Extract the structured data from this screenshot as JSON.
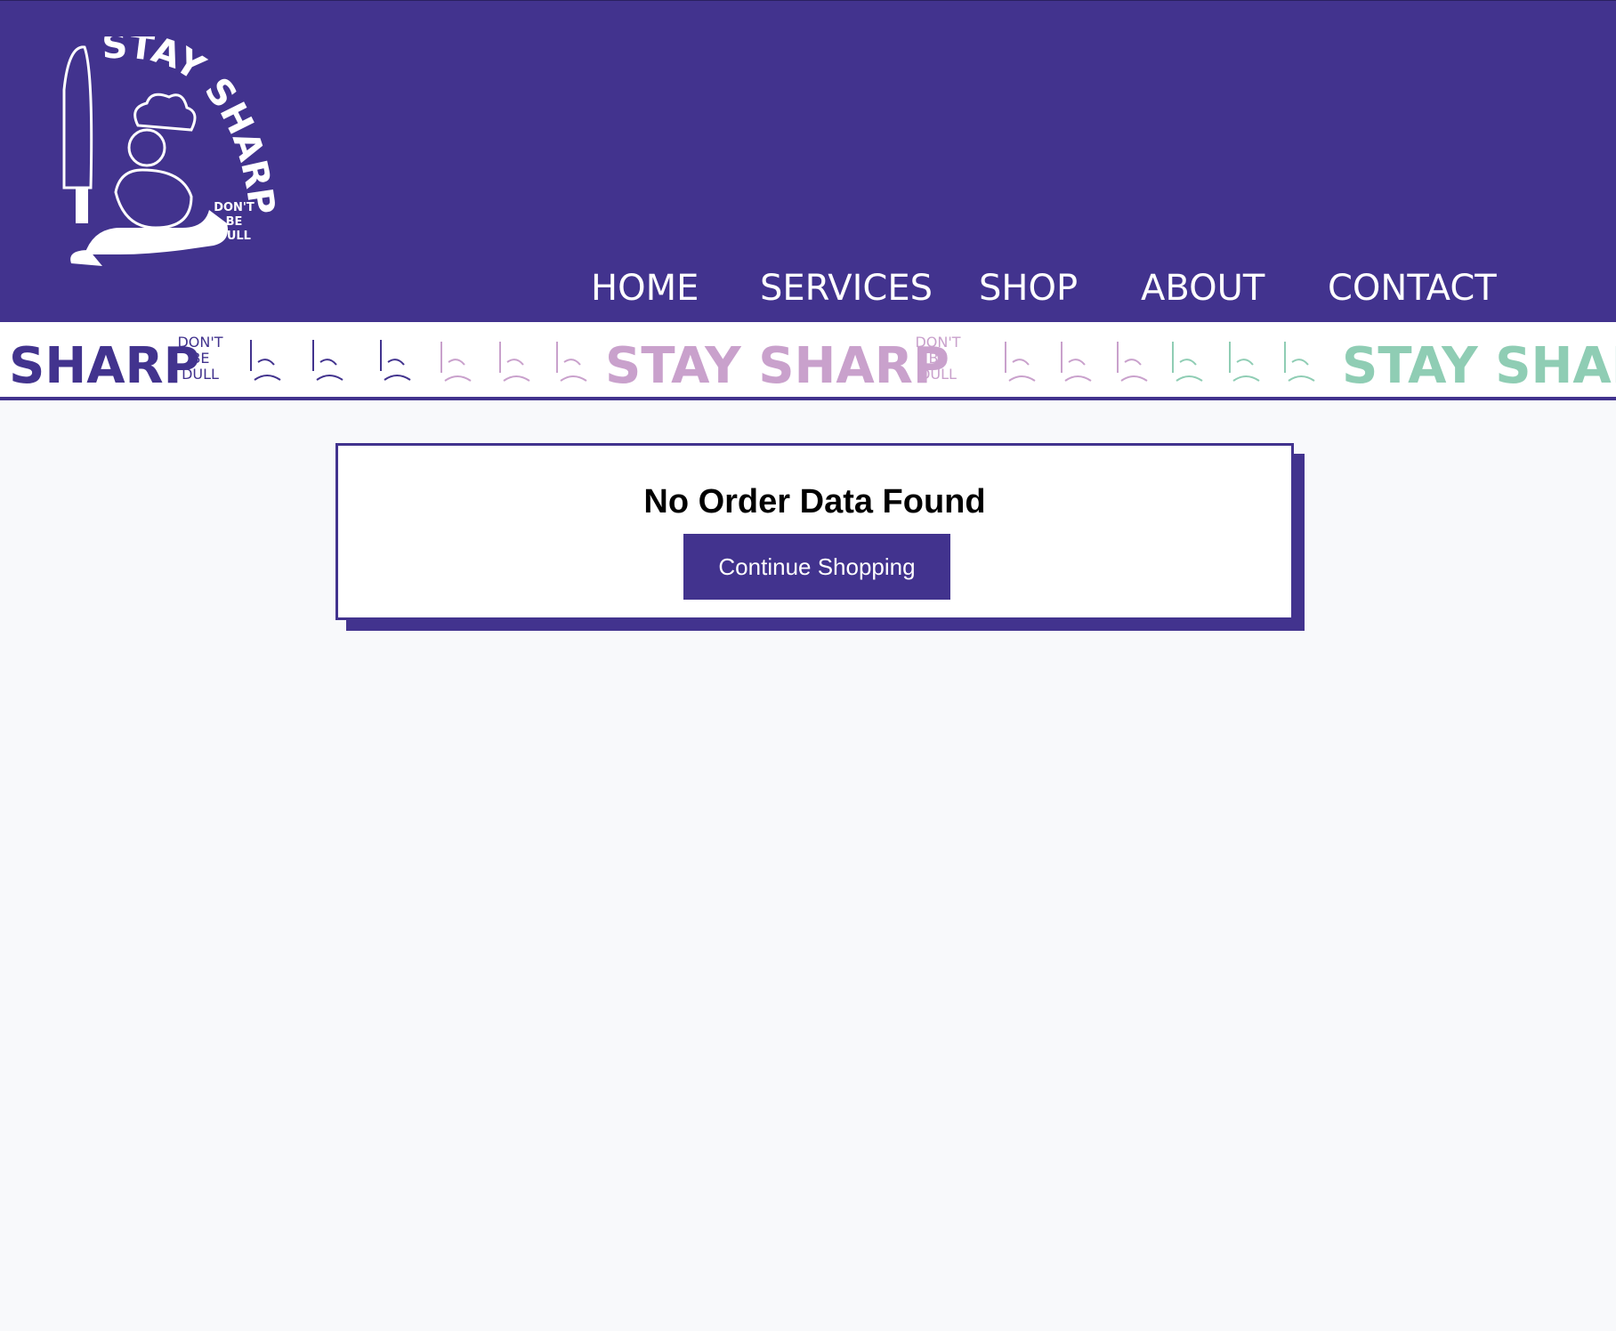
{
  "brand": {
    "logo_text": "STAY SHARP",
    "logo_tagline": "DON'T BE DULL",
    "colors": {
      "primary": "#42338e",
      "lavender": "#c9a1cc",
      "mint": "#8fcdb4",
      "page_bg": "#f8f9fb",
      "white": "#ffffff"
    }
  },
  "nav": {
    "items": [
      {
        "label": "HOME"
      },
      {
        "label": "SERVICES"
      },
      {
        "label": "SHOP"
      },
      {
        "label": "ABOUT"
      },
      {
        "label": "CONTACT"
      }
    ]
  },
  "banner": {
    "segments": [
      {
        "word": "SHARP",
        "tagline": [
          "DON'T",
          "BE",
          "DULL"
        ],
        "color": "#42338e"
      },
      {
        "word": "STAY SHARP",
        "tagline": [
          "DON'T",
          "BE",
          "DULL"
        ],
        "color": "#c9a1cc"
      },
      {
        "word": "STAY SHAR",
        "color": "#8fcdb4"
      }
    ],
    "icon": "running-chef-icon"
  },
  "order": {
    "message": "No Order Data Found",
    "continue_label": "Continue Shopping"
  }
}
